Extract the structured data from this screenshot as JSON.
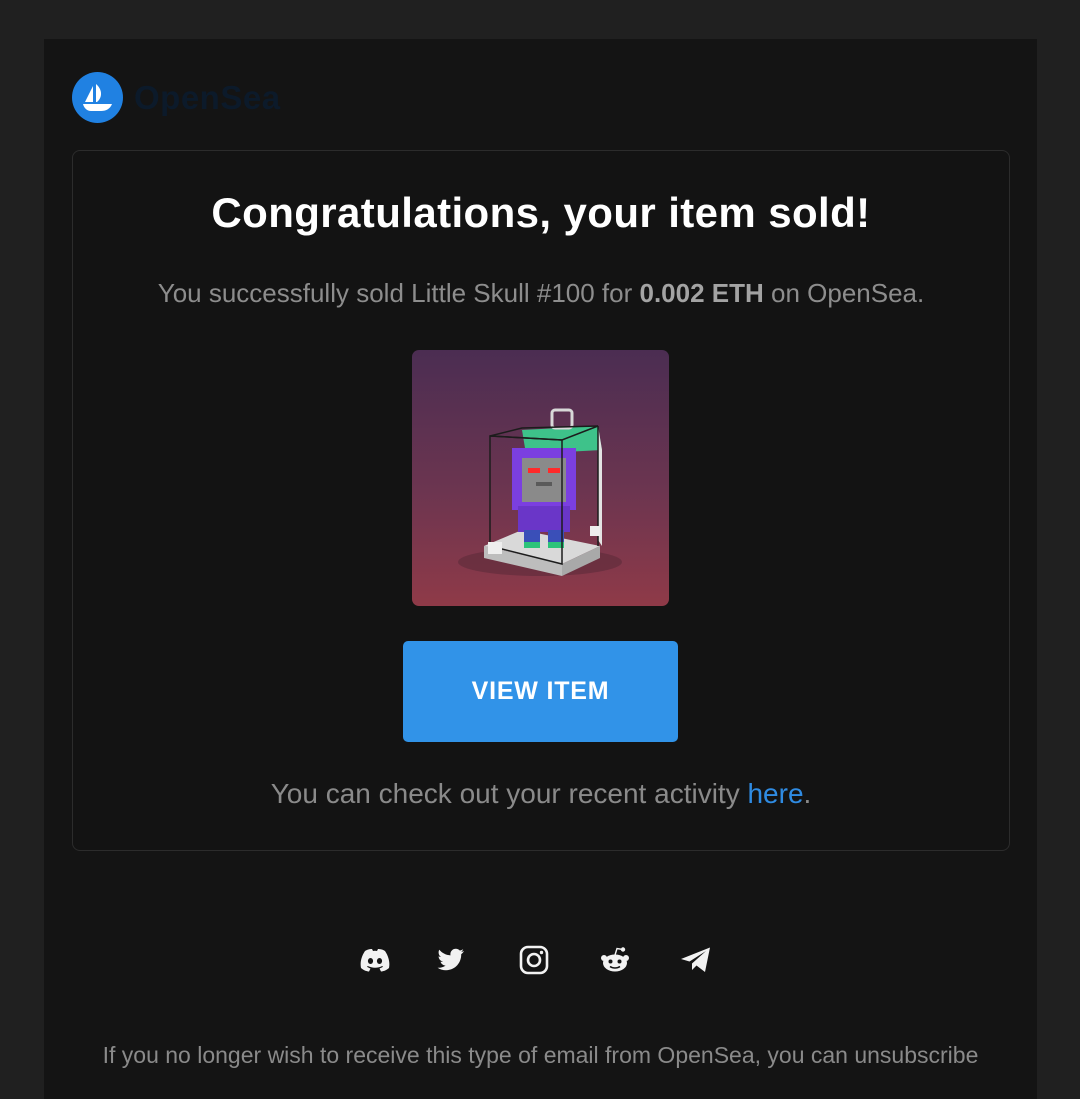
{
  "brand": {
    "name": "OpenSea",
    "icon": "opensea-ship-logo",
    "logo_color": "#2081e2"
  },
  "email": {
    "headline": "Congratulations, your item sold!",
    "sold_prefix": "You successfully sold Little Skull #100 for ",
    "sold_price": "0.002 ETH",
    "sold_suffix": " on OpenSea.",
    "item_image_alt": "Little Skull #100",
    "view_button_label": "VIEW ITEM",
    "activity_prefix": "You can check out your recent activity ",
    "activity_link": "here",
    "activity_suffix": ".",
    "accent_color": "#3193e8"
  },
  "social": [
    {
      "icon": "discord-icon"
    },
    {
      "icon": "twitter-icon"
    },
    {
      "icon": "instagram-icon"
    },
    {
      "icon": "reddit-icon"
    },
    {
      "icon": "telegram-icon"
    }
  ],
  "footer": {
    "text": "If you no longer wish to receive this type of email from OpenSea, you can unsubscribe"
  }
}
